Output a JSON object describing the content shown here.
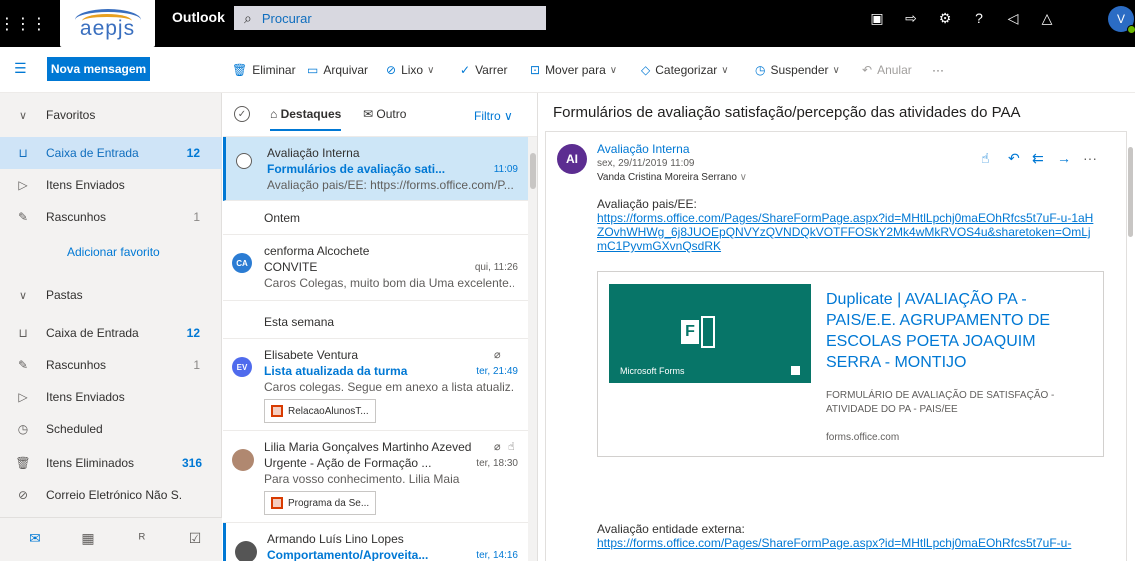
{
  "topbar": {
    "app_name": "Outlook",
    "logo_text": "aepjs",
    "search_placeholder": "Procurar",
    "avatar_initial": "V"
  },
  "toolbar": {
    "new_message": "Nova mensagem",
    "delete": "Eliminar",
    "archive": "Arquivar",
    "junk": "Lixo",
    "sweep": "Varrer",
    "move_to": "Mover para",
    "categorize": "Categorizar",
    "snooze": "Suspender",
    "undo": "Anular",
    "more": "···"
  },
  "nav": {
    "favorites_header": "Favoritos",
    "favorites": [
      {
        "label": "Caixa de Entrada",
        "count": "12",
        "icon": "inbox-icon",
        "selected": true
      },
      {
        "label": "Itens Enviados",
        "count": "",
        "icon": "sent-icon"
      },
      {
        "label": "Rascunhos",
        "count": "1",
        "icon": "drafts-icon"
      }
    ],
    "add_favorite": "Adicionar favorito",
    "folders_header": "Pastas",
    "folders": [
      {
        "label": "Caixa de Entrada",
        "count": "12",
        "icon": "inbox-icon"
      },
      {
        "label": "Rascunhos",
        "count": "1",
        "icon": "drafts-icon"
      },
      {
        "label": "Itens Enviados",
        "count": "",
        "icon": "sent-icon"
      },
      {
        "label": "Scheduled",
        "count": "",
        "icon": "clock-icon"
      },
      {
        "label": "Itens Eliminados",
        "count": "316",
        "icon": "trash-icon"
      },
      {
        "label": "Correio Eletrónico Não S...",
        "count": "",
        "icon": "blocked-icon"
      }
    ]
  },
  "list": {
    "tab_focused": "Destaques",
    "tab_other": "Outro",
    "filter": "Filtro",
    "group_yesterday": "Ontem",
    "group_week": "Esta semana",
    "messages": [
      {
        "sender": "Avaliação Interna",
        "subject": "Formulários de avaliação sati...",
        "time": "11:09",
        "preview": "Avaliação pais/EE: https://forms.office.com/P..."
      },
      {
        "sender": "cenforma Alcochete",
        "subject": "CONVITE",
        "time": "qui, 11:26",
        "preview": "Caros Colegas, muito bom dia Uma excelente...",
        "avatar": "CA",
        "avatar_color": "#2b7cd3"
      },
      {
        "sender": "Elisabete Ventura",
        "subject": "Lista atualizada da turma",
        "time": "ter, 21:49",
        "preview": "Caros colegas. Segue em anexo a lista atualiz...",
        "avatar": "EV",
        "avatar_color": "#4f6bed",
        "attachment": "RelacaoAlunosT..."
      },
      {
        "sender": "Lilia Maria Gonçalves Martinho Azeved",
        "subject": "Urgente - Ação de Formação ...",
        "time": "ter, 18:30",
        "preview": "Para vosso conhecimento. Lilia Maia",
        "attachment": "Programa da Se..."
      },
      {
        "sender": "Armando Luís Lino Lopes",
        "subject": "Comportamento/Aproveita...",
        "time": "ter, 14:16",
        "preview": ""
      }
    ]
  },
  "reading": {
    "subject": "Formulários de avaliação satisfação/percepção das atividades do PAA",
    "avatar": "AI",
    "from": "Avaliação Interna",
    "date": "sex, 29/11/2019 11:09",
    "to": "Vanda Cristina Moreira Serrano",
    "body_label1": "Avaliação pais/EE:",
    "body_link1": "https://forms.office.com/Pages/ShareFormPage.aspx?id=MHtlLpchj0maEOhRfcs5t7uF-u-1aHZOvhWHWg_6j8JUOEpQNVYzQVNDQkVOTFFOSkY2Mk4wMkRVOS4u&sharetoken=OmLjmC1PyvmGXvnQsdRK",
    "preview_title": "Duplicate | AVALIAÇÃO PA - PAIS/E.E. AGRUPAMENTO DE ESCOLAS POETA JOAQUIM SERRA - MONTIJO",
    "preview_desc": "FORMULÁRIO DE AVALIAÇÃO DE SATISFAÇÃO - ATIVIDADE DO PA - PAIS/EE",
    "preview_domain": "forms.office.com",
    "preview_brand": "Microsoft Forms",
    "body_label2": "Avaliação entidade externa:",
    "body_link2": "https://forms.office.com/Pages/ShareFormPage.aspx?id=MHtlLpchj0maEOhRfcs5t7uF-u-"
  }
}
